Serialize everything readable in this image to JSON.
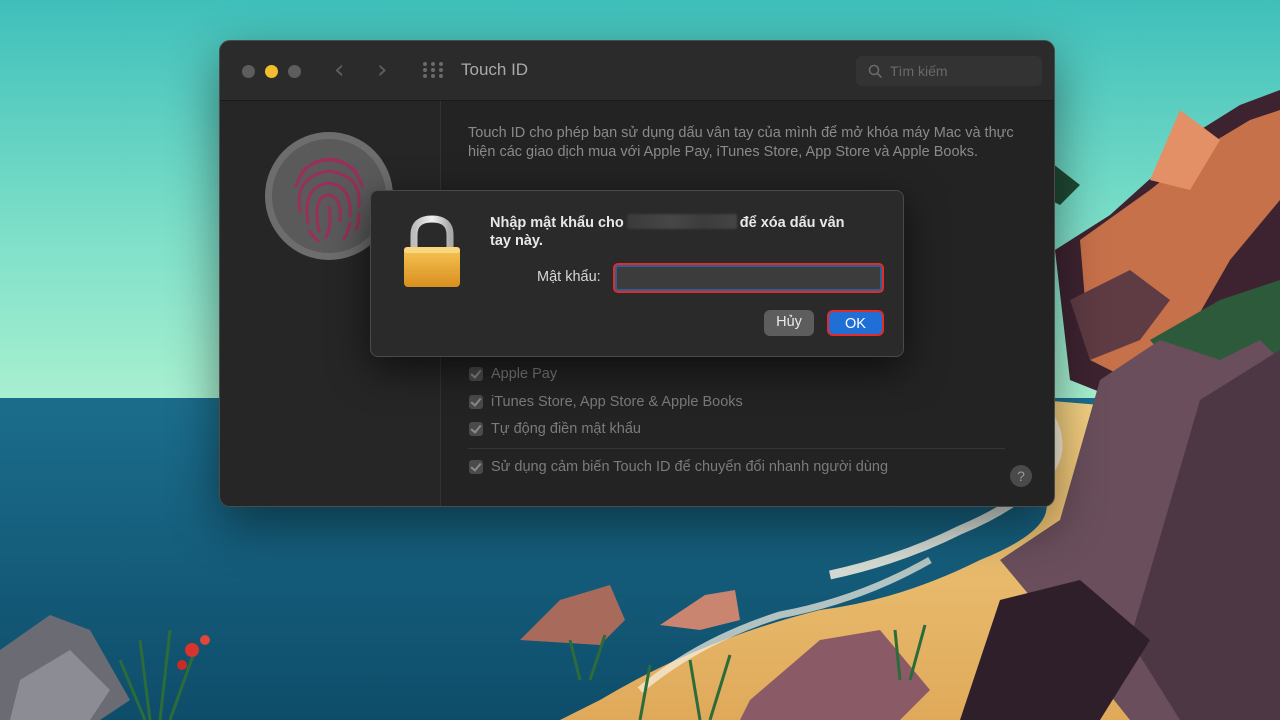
{
  "window": {
    "title": "Touch ID",
    "search_placeholder": "Tìm kiếm"
  },
  "content": {
    "description": "Touch ID cho phép bạn sử dụng dấu vân tay của mình để mở khóa máy Mac và thực hiện các giao dịch mua với Apple Pay, iTunes Store, App Store và Apple Books.",
    "options": [
      {
        "label": "Apple Pay",
        "checked": true
      },
      {
        "label": "iTunes Store, App Store & Apple Books",
        "checked": true
      },
      {
        "label": "Tự động điền mật khẩu",
        "checked": true
      }
    ],
    "fast_switch": {
      "label": "Sử dụng cảm biến Touch ID để chuyển đổi nhanh người dùng",
      "checked": true
    },
    "help_label": "?"
  },
  "dialog": {
    "prompt_part1": "Nhập mật khẩu cho",
    "prompt_part2": "để xóa dấu vân",
    "prompt_line2": "tay này.",
    "password_label": "Mật khẩu:",
    "password_value": "",
    "cancel_label": "Hủy",
    "ok_label": "OK"
  },
  "colors": {
    "accent": "#1f6fd6",
    "highlight": "#e22b2b",
    "lock_body": "#f0b23b",
    "traffic_min": "#f5bc2f"
  },
  "icons": [
    "close-icon",
    "minimize-icon",
    "zoom-icon",
    "chevron-left-icon",
    "chevron-right-icon",
    "grid-icon",
    "search-icon",
    "fingerprint-icon",
    "lock-icon",
    "checkmark-icon",
    "help-icon"
  ]
}
